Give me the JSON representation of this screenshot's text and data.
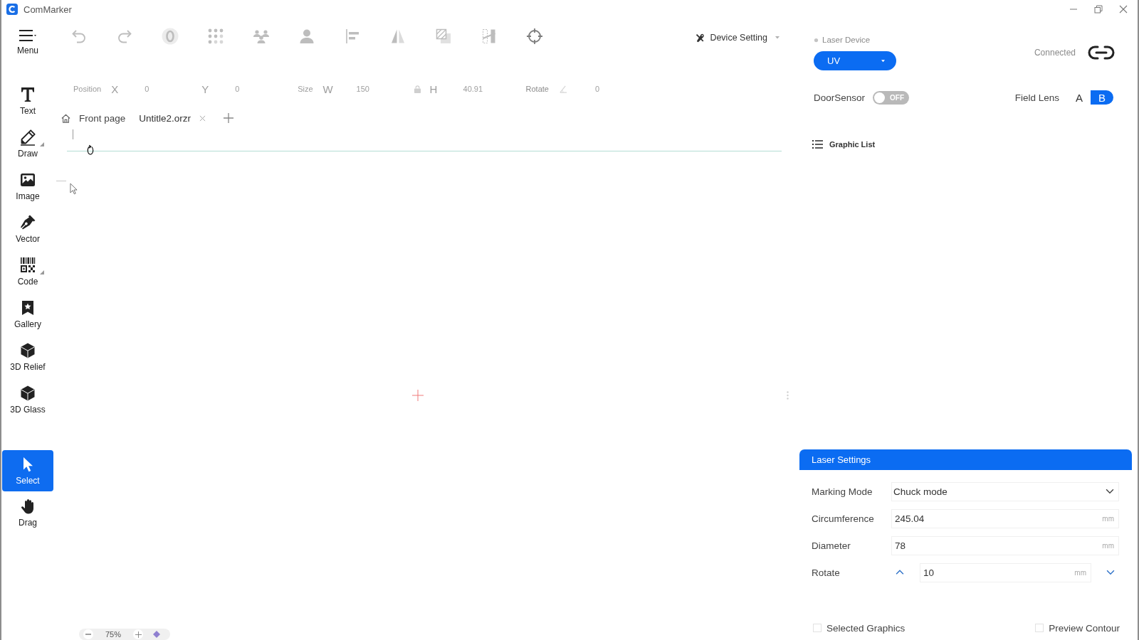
{
  "window": {
    "title": "ComMarker"
  },
  "menu": {
    "label": "Menu"
  },
  "toolbar": {
    "tools": [
      {
        "kind": "undo",
        "disabled": true
      },
      {
        "kind": "redo",
        "disabled": true
      },
      {
        "kind": "zero",
        "disabled": true
      },
      {
        "kind": "array",
        "disabled": true
      },
      {
        "kind": "group",
        "disabled": true
      },
      {
        "kind": "person",
        "disabled": true
      },
      {
        "kind": "align",
        "disabled": true
      },
      {
        "kind": "mirror",
        "disabled": true
      },
      {
        "kind": "hatch",
        "disabled": true
      },
      {
        "kind": "split",
        "disabled": true
      },
      {
        "kind": "target",
        "disabled": false
      }
    ],
    "device_setting": {
      "label": "Device Setting"
    }
  },
  "sidebar": {
    "tools": [
      {
        "kind": "text",
        "label": "Text",
        "submenu": false
      },
      {
        "kind": "draw",
        "label": "Draw",
        "submenu": true
      },
      {
        "kind": "image",
        "label": "Image",
        "submenu": false
      },
      {
        "kind": "vector",
        "label": "Vector",
        "submenu": false
      },
      {
        "kind": "code",
        "label": "Code",
        "submenu": true
      },
      {
        "kind": "gallery",
        "label": "Gallery",
        "submenu": false
      },
      {
        "kind": "relief",
        "label": "3D Relief",
        "submenu": false
      },
      {
        "kind": "glass",
        "label": "3D Glass",
        "submenu": false
      }
    ],
    "modes": [
      {
        "kind": "select",
        "label": "Select",
        "selected": true
      },
      {
        "kind": "drag",
        "label": "Drag",
        "selected": false
      }
    ]
  },
  "properties": {
    "disabled": true,
    "groups": [
      {
        "kind": "pair",
        "label": "Position",
        "fields": [
          {
            "axis": "X",
            "value": "0"
          },
          {
            "axis": "Y",
            "value": "0"
          }
        ]
      },
      {
        "kind": "linked",
        "label": "Size",
        "fields": [
          {
            "axis": "W",
            "value": "150"
          },
          {
            "axis": "H",
            "value": "40.91"
          }
        ]
      },
      {
        "kind": "angle",
        "label": "Rotate",
        "fields": [
          {
            "value": "0"
          }
        ]
      }
    ]
  },
  "tabs": [
    {
      "kind": "home",
      "label": "Front page",
      "selected": false,
      "closable": false
    },
    {
      "kind": "file",
      "label": "Untitle2.orzr",
      "selected": true,
      "closable": true
    }
  ],
  "zoom": {
    "value": "75%"
  },
  "laser_device": {
    "label": "Laser Device",
    "value": "UV"
  },
  "connection": {
    "label": "Connected",
    "connected": true
  },
  "door_sensor": {
    "label": "DoorSensor",
    "on": false,
    "state_text": "OFF"
  },
  "field_lens": {
    "label": "Field Lens",
    "options": [
      {
        "label": "A",
        "selected": false
      },
      {
        "label": "B",
        "selected": true
      }
    ]
  },
  "graphic_list": {
    "title": "Graphic List"
  },
  "laser_settings": {
    "title": "Laser Settings",
    "rows": [
      {
        "kind": "select",
        "label": "Marking Mode",
        "value": "Chuck mode"
      },
      {
        "kind": "input",
        "label": "Circumference",
        "value": "245.04",
        "unit": "mm"
      },
      {
        "kind": "input",
        "label": "Diameter",
        "value": "78",
        "unit": "mm"
      },
      {
        "kind": "stepper",
        "label": "Rotate",
        "value": "10",
        "unit": "mm"
      }
    ],
    "options": [
      {
        "label": "Selected Graphics",
        "checked": false
      },
      {
        "label": "Preview Contour",
        "checked": false
      }
    ]
  }
}
